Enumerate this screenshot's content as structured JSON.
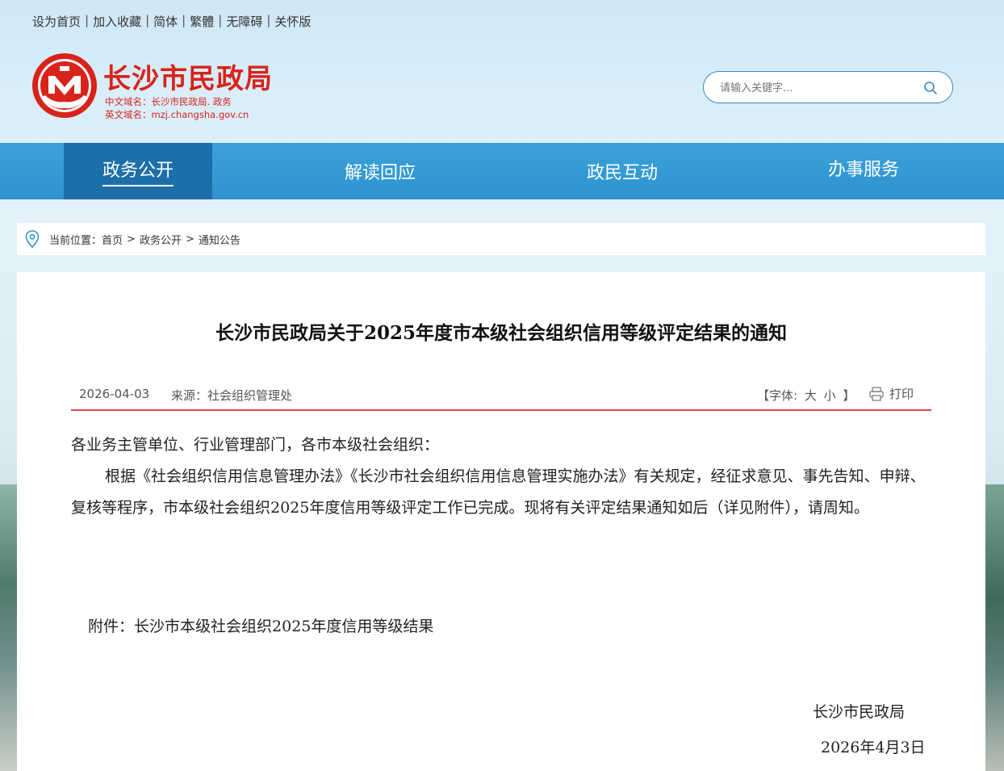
{
  "top_links": [
    "设为首页",
    "加入收藏",
    "简体",
    "繁體",
    "无障碍",
    "关怀版"
  ],
  "logo": {
    "title": "长沙市民政局",
    "cn_domain": "中文域名：长沙市民政局. 政务",
    "en_domain": "英文域名：mzj.changsha.gov.cn"
  },
  "search": {
    "placeholder": "请输入关键字..."
  },
  "nav": [
    "政务公开",
    "解读回应",
    "政民互动",
    "办事服务"
  ],
  "breadcrumb": {
    "prefix": "当前位置：",
    "items": [
      "首页",
      "政务公开",
      "通知公告"
    ],
    "separator": ">"
  },
  "article": {
    "title": "长沙市民政局关于2025年度市本级社会组织信用等级评定结果的通知",
    "date": "2026-04-03",
    "source": "来源：社会组织管理处",
    "font_label": "【字体:",
    "font_large": "大",
    "font_small": "小",
    "font_close": "】",
    "print_label": "打印",
    "salutation": "各业务主管单位、行业管理部门，各市本级社会组织：",
    "paragraph": "根据《社会组织信用信息管理办法》《长沙市社会组织信用信息管理实施办法》有关规定，经征求意见、事先告知、申辩、复核等程序，市本级社会组织2025年度信用等级评定工作已完成。现将有关评定结果通知如后（详见附件），请周知。",
    "attachment_label": "附件：",
    "attachment_link": "长沙市本级社会组织2025年度信用等级结果",
    "signature": "长沙市民政局",
    "sign_date": "2026年4月3日"
  },
  "colors": {
    "brand_red": "#d8231b",
    "nav_blue": "#3ba2d8",
    "nav_active": "#1c6fa8",
    "meta_line": "#e0444d"
  }
}
